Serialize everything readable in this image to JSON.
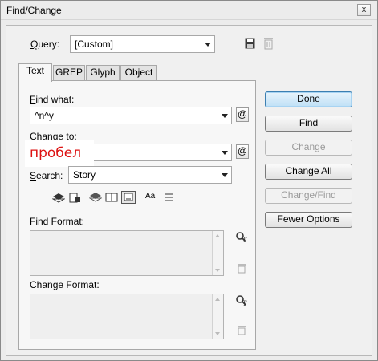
{
  "window": {
    "title": "Find/Change",
    "close_glyph": "x"
  },
  "query": {
    "label_prefix": "Q",
    "label_rest": "uery:",
    "value": "[Custom]"
  },
  "tabs": [
    "Text",
    "GREP",
    "Glyph",
    "Object"
  ],
  "find_what": {
    "label_u": "F",
    "label_rest": "ind what:",
    "value": "^n^y"
  },
  "change_to": {
    "label": "Change to:",
    "value": ""
  },
  "search": {
    "label_u": "S",
    "label_rest": "earch:",
    "value": "Story"
  },
  "overlay_text": "пробел",
  "buttons": {
    "done": "Done",
    "find": "Find",
    "change": "Change",
    "change_all": "Change All",
    "change_find": "Change/Find",
    "fewer_options": "Fewer Options"
  },
  "find_format": {
    "label": "Find Format:"
  },
  "change_format": {
    "label": "Change Format:"
  },
  "option_icons": [
    "layers-lock-icon",
    "locked-stories-icon",
    "hidden-layers-icon",
    "master-pages-icon",
    "footnotes-icon",
    "case-sensitive-icon",
    "whole-word-icon"
  ],
  "glyphs": {
    "at": "@",
    "case": "Aa"
  }
}
